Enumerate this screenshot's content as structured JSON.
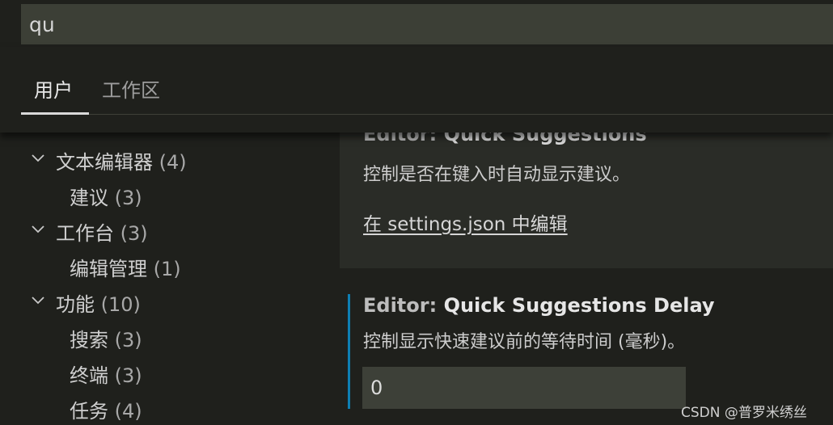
{
  "search": {
    "value": "qu"
  },
  "tabs": [
    {
      "label": "用户",
      "active": true
    },
    {
      "label": "工作区",
      "active": false
    }
  ],
  "tree": [
    {
      "label": "文本编辑器",
      "count": "(4)",
      "level": 0
    },
    {
      "label": "建议",
      "count": "(3)",
      "level": 1
    },
    {
      "label": "工作台",
      "count": "(3)",
      "level": 0
    },
    {
      "label": "编辑管理",
      "count": "(1)",
      "level": 1
    },
    {
      "label": "功能",
      "count": "(10)",
      "level": 0
    },
    {
      "label": "搜索",
      "count": "(3)",
      "level": 1
    },
    {
      "label": "终端",
      "count": "(3)",
      "level": 1
    },
    {
      "label": "任务",
      "count": "(4)",
      "level": 1
    }
  ],
  "settings": [
    {
      "category": "Editor: ",
      "name": "Quick Suggestions",
      "description": "控制是否在键入时自动显示建议。",
      "edit_link": "在 settings.json 中编辑"
    },
    {
      "category": "Editor: ",
      "name": "Quick Suggestions Delay",
      "description": "控制显示快速建议前的等待时间 (毫秒)。",
      "value": "0"
    }
  ],
  "colors": {
    "accent_modified": "#0e7fb3",
    "background": "#1f201c",
    "input_background": "#3c3f36"
  },
  "watermark": "CSDN @普罗米绣丝"
}
